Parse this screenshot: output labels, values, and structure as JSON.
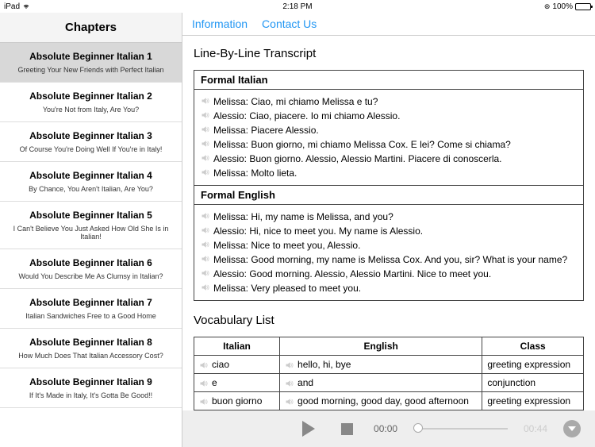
{
  "status": {
    "carrier": "iPad",
    "time": "2:18 PM",
    "battery": "100%"
  },
  "sidebar": {
    "title": "Chapters",
    "chapters": [
      {
        "title": "Absolute Beginner Italian 1",
        "sub": "Greeting Your New Friends with Perfect Italian"
      },
      {
        "title": "Absolute Beginner Italian 2",
        "sub": "You're Not from Italy, Are You?"
      },
      {
        "title": "Absolute Beginner Italian 3",
        "sub": "Of Course You're Doing Well If You're in Italy!"
      },
      {
        "title": "Absolute Beginner Italian 4",
        "sub": "By Chance, You Aren't Italian, Are You?"
      },
      {
        "title": "Absolute Beginner Italian 5",
        "sub": "I Can't Believe You Just Asked How Old She Is in Italian!"
      },
      {
        "title": "Absolute Beginner Italian 6",
        "sub": "Would You Describe Me As Clumsy in Italian?"
      },
      {
        "title": "Absolute Beginner Italian 7",
        "sub": "Italian Sandwiches Free to a Good Home"
      },
      {
        "title": "Absolute Beginner Italian 8",
        "sub": "How Much Does That Italian Accessory Cost?"
      },
      {
        "title": "Absolute Beginner Italian 9",
        "sub": "If It's Made in Italy, It's Gotta Be Good!!"
      }
    ]
  },
  "header": {
    "information": "Information",
    "contact": "Contact Us"
  },
  "transcript": {
    "title": "Line-By-Line Transcript",
    "formal_italian": {
      "header": "Formal Italian",
      "lines": [
        "Melissa: Ciao, mi chiamo Melissa e tu?",
        "Alessio: Ciao, piacere. Io mi chiamo Alessio.",
        "Melissa: Piacere Alessio.",
        "Melissa: Buon giorno, mi chiamo Melissa Cox. E lei? Come si chiama?",
        "Alessio: Buon giorno. Alessio, Alessio Martini. Piacere di conoscerla.",
        "Melissa: Molto lieta."
      ]
    },
    "formal_english": {
      "header": "Formal English",
      "lines": [
        "Melissa: Hi, my name is Melissa, and you?",
        "Alessio: Hi, nice to meet you. My name is Alessio.",
        "Melissa: Nice to meet you, Alessio.",
        "Melissa: Good morning, my name is Melissa Cox. And you, sir? What is your name?",
        "Alessio: Good morning. Alessio, Alessio Martini. Nice to meet you.",
        "Melissa: Very pleased to meet you."
      ]
    }
  },
  "vocab": {
    "title": "Vocabulary List",
    "headers": {
      "italian": "Italian",
      "english": "English",
      "class": "Class"
    },
    "rows": [
      {
        "it": "ciao",
        "en": "hello, hi, bye",
        "cl": "greeting expression"
      },
      {
        "it": "e",
        "en": "and",
        "cl": "conjunction"
      },
      {
        "it": "buon giorno",
        "en": "good morning, good day, good afternoon",
        "cl": "greeting expression"
      }
    ]
  },
  "audio": {
    "current": "00:00",
    "total": "00:44"
  }
}
